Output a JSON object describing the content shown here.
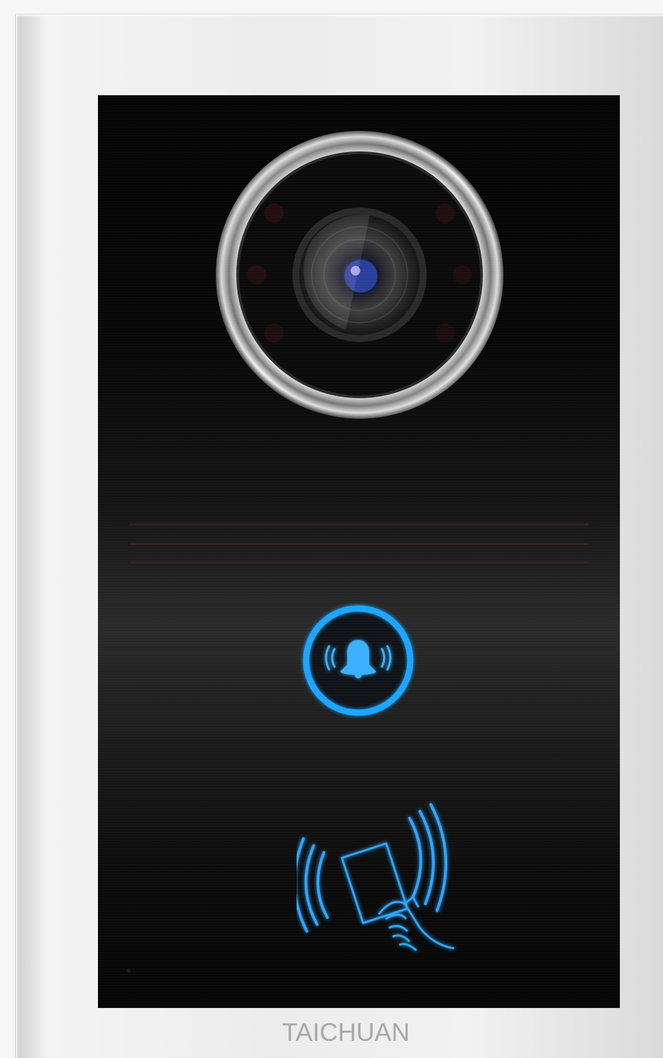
{
  "brand": {
    "name": "TAICHUAN"
  },
  "colors": {
    "frame": "#eeeeee",
    "panel": "#0b0b0b",
    "accent_blue": "#1fa5ff",
    "brand_text": "#a8a8a8"
  },
  "icons": {
    "camera": "camera-lens-icon",
    "call": "bell-icon",
    "card": "rfid-card-icon"
  }
}
